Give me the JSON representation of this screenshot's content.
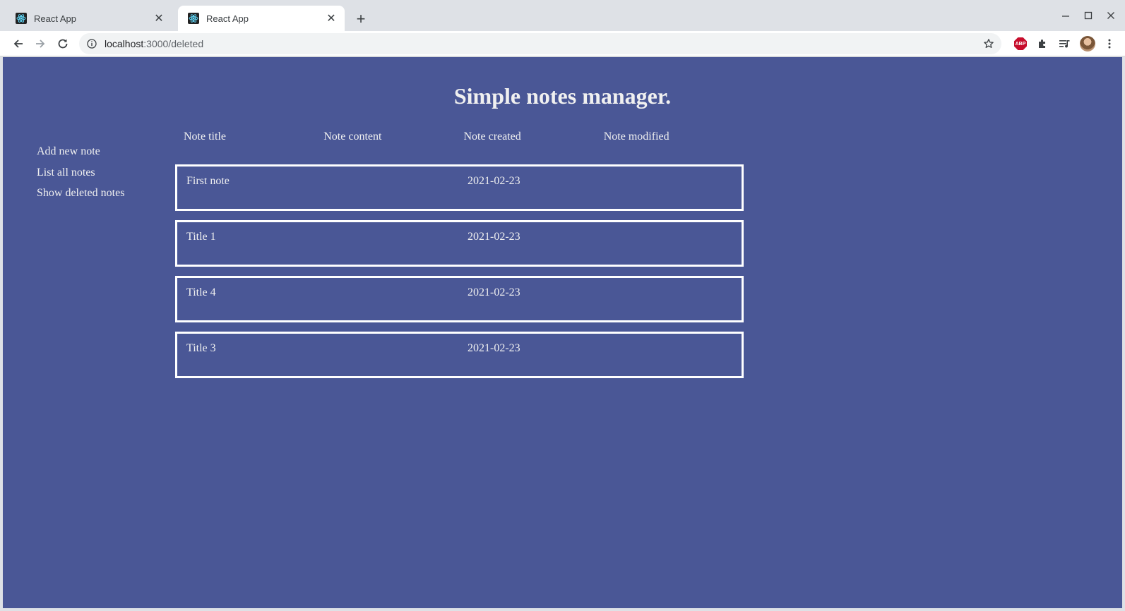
{
  "browser": {
    "tabs": [
      {
        "title": "React App",
        "active": false
      },
      {
        "title": "React App",
        "active": true
      }
    ],
    "url_host": "localhost",
    "url_rest": ":3000/deleted"
  },
  "page": {
    "title": "Simple notes manager.",
    "nav": [
      "Add new note",
      "List all notes",
      "Show deleted notes"
    ],
    "columns": [
      "Note title",
      "Note content",
      "Note created",
      "Note modified"
    ],
    "notes": [
      {
        "title": "First note",
        "created": "2021-02-23"
      },
      {
        "title": "Title 1",
        "created": "2021-02-23"
      },
      {
        "title": "Title 4",
        "created": "2021-02-23"
      },
      {
        "title": "Title 3",
        "created": "2021-02-23"
      }
    ]
  },
  "colors": {
    "page_background": "#4a5796",
    "text": "#f0f0f0",
    "row_border": "#ffffff"
  }
}
